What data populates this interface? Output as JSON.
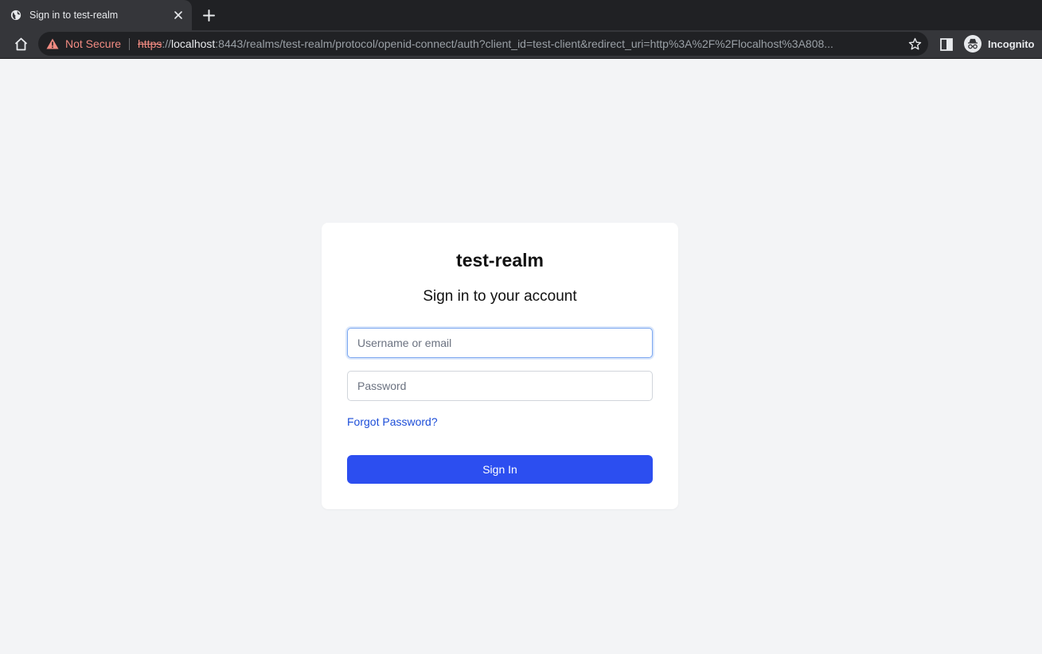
{
  "browser": {
    "tab": {
      "title": "Sign in to test-realm",
      "favicon": "globe-icon"
    },
    "address_bar": {
      "security_label": "Not Secure",
      "url_scheme": "https",
      "url_sep": "://",
      "url_host": "localhost",
      "url_rest": ":8443/realms/test-realm/protocol/openid-connect/auth?client_id=test-client&redirect_uri=http%3A%2F%2Flocalhost%3A808..."
    },
    "profile_label": "Incognito",
    "colors": {
      "warning": "#f28b82",
      "chrome": "#35363a",
      "tabstrip": "#202124"
    }
  },
  "login": {
    "realm_title": "test-realm",
    "heading": "Sign in to your account",
    "username": {
      "placeholder": "Username or email",
      "value": ""
    },
    "password": {
      "placeholder": "Password",
      "value": ""
    },
    "forgot_link": "Forgot Password?",
    "submit_label": "Sign In",
    "colors": {
      "primary": "#2c4ef0",
      "link": "#1d4ed8",
      "background": "#f3f4f6"
    }
  }
}
